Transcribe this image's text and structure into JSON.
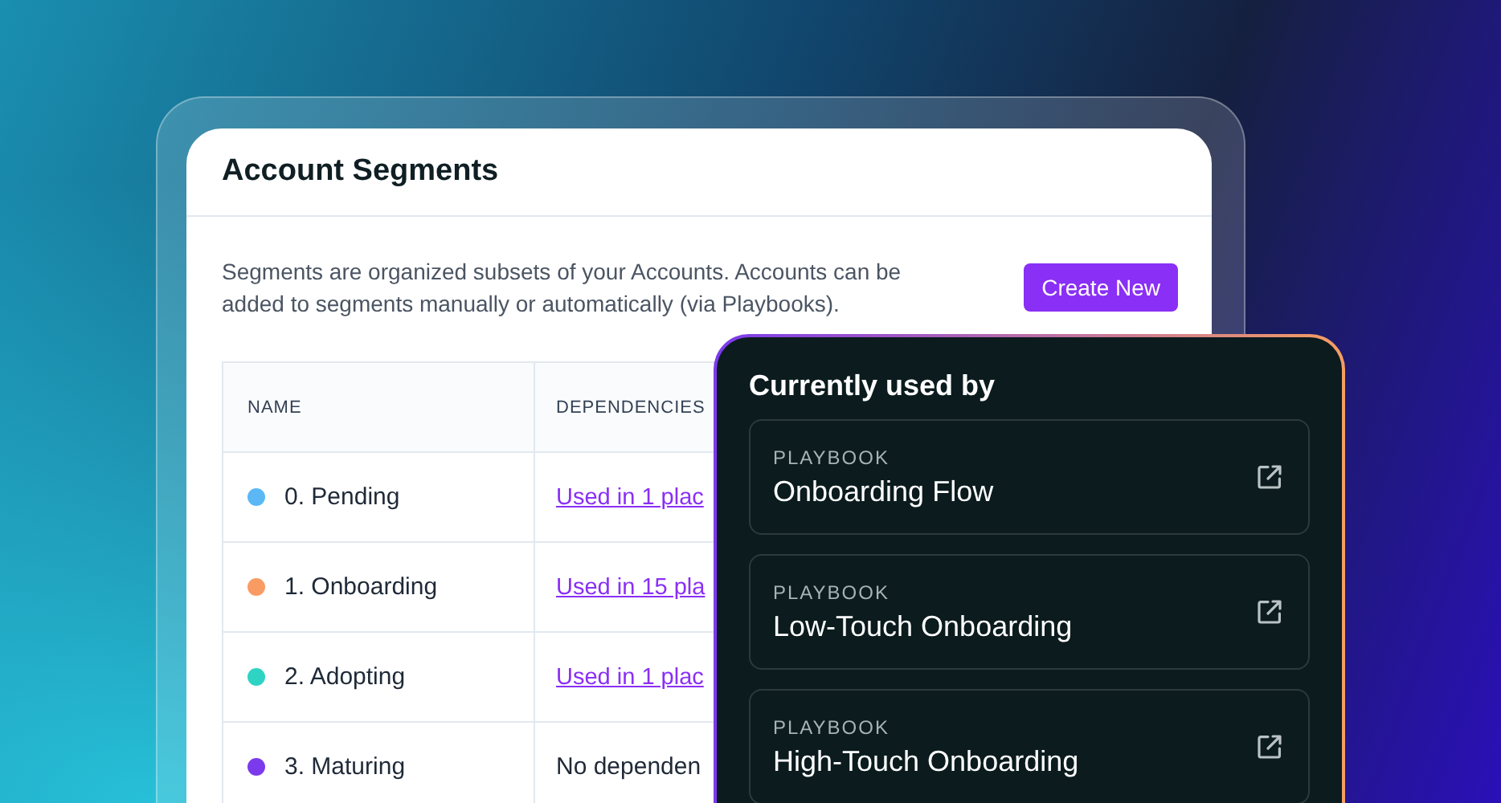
{
  "panel": {
    "title": "Account Segments",
    "description": "Segments are organized subsets of your Accounts. Accounts can be added to segments manually or automatically (via Playbooks).",
    "create_button": "Create New"
  },
  "table": {
    "columns": [
      "NAME",
      "DEPENDENCIES"
    ],
    "rows": [
      {
        "name": "0. Pending",
        "color": "#5bb8f5",
        "dependencies": "Used in 1 plac",
        "kind": "link"
      },
      {
        "name": "1. Onboarding",
        "color": "#f99c63",
        "dependencies": "Used in 15 pla",
        "kind": "link"
      },
      {
        "name": "2. Adopting",
        "color": "#2fd3c3",
        "dependencies": "Used in 1 plac",
        "kind": "link"
      },
      {
        "name": "3. Maturing",
        "color": "#7c3aed",
        "dependencies": "No dependen",
        "kind": "text"
      }
    ]
  },
  "popover": {
    "title": "Currently used by",
    "items": [
      {
        "type": "PLAYBOOK",
        "name": "Onboarding Flow"
      },
      {
        "type": "PLAYBOOK",
        "name": "Low-Touch Onboarding"
      },
      {
        "type": "PLAYBOOK",
        "name": "High-Touch Onboarding"
      }
    ]
  }
}
